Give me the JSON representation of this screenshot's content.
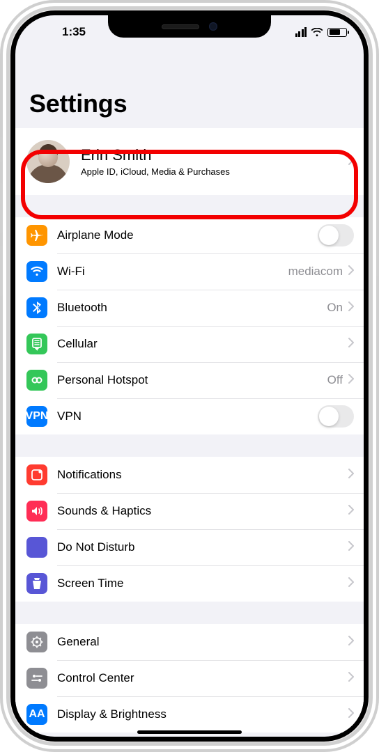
{
  "status": {
    "time": "1:35"
  },
  "page": {
    "title": "Settings",
    "appleId": {
      "name": "Erin Smith",
      "subtitle": "Apple ID, iCloud, Media & Purchases"
    },
    "group1": [
      {
        "key": "airplane",
        "label": "Airplane Mode",
        "toggle": false,
        "iconColor": "#ff9500"
      },
      {
        "key": "wifi",
        "label": "Wi-Fi",
        "value": "mediacom",
        "chevron": true,
        "iconColor": "#007aff"
      },
      {
        "key": "bluetooth",
        "label": "Bluetooth",
        "value": "On",
        "chevron": true,
        "iconColor": "#007aff"
      },
      {
        "key": "cellular",
        "label": "Cellular",
        "chevron": true,
        "iconColor": "#34c759"
      },
      {
        "key": "hotspot",
        "label": "Personal Hotspot",
        "value": "Off",
        "chevron": true,
        "iconColor": "#34c759"
      },
      {
        "key": "vpn",
        "label": "VPN",
        "toggle": false,
        "iconColor": "#007aff",
        "iconText": "VPN"
      }
    ],
    "group2": [
      {
        "key": "notifications",
        "label": "Notifications",
        "chevron": true,
        "iconColor": "#ff3b30"
      },
      {
        "key": "sounds",
        "label": "Sounds & Haptics",
        "chevron": true,
        "iconColor": "#ff2d55"
      },
      {
        "key": "dnd",
        "label": "Do Not Disturb",
        "chevron": true,
        "iconColor": "#5856d6"
      },
      {
        "key": "screenTime",
        "label": "Screen Time",
        "chevron": true,
        "iconColor": "#5856d6"
      }
    ],
    "group3": [
      {
        "key": "general",
        "label": "General",
        "chevron": true,
        "iconColor": "#8e8e93"
      },
      {
        "key": "controlCenter",
        "label": "Control Center",
        "chevron": true,
        "iconColor": "#8e8e93"
      },
      {
        "key": "display",
        "label": "Display & Brightness",
        "chevron": true,
        "iconColor": "#007aff",
        "iconText": "AA"
      }
    ]
  }
}
